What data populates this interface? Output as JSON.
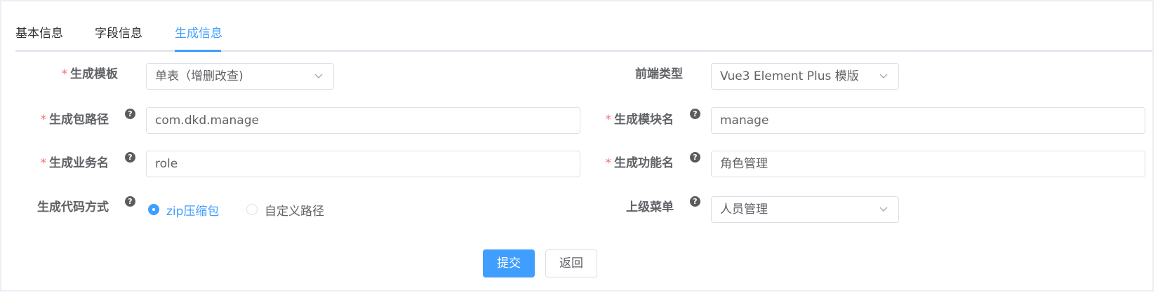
{
  "tabs": [
    {
      "label": "基本信息",
      "active": false
    },
    {
      "label": "字段信息",
      "active": false
    },
    {
      "label": "生成信息",
      "active": true
    }
  ],
  "form": {
    "tpl_category": {
      "label": "生成模板",
      "required": true,
      "value": "单表（增删改查)"
    },
    "tpl_web_type": {
      "label": "前端类型",
      "required": false,
      "value": "Vue3 Element Plus 模版"
    },
    "package_name": {
      "label": "生成包路径",
      "required": true,
      "value": "com.dkd.manage"
    },
    "module_name": {
      "label": "生成模块名",
      "required": true,
      "value": "manage"
    },
    "business_name": {
      "label": "生成业务名",
      "required": true,
      "value": "role"
    },
    "function_name": {
      "label": "生成功能名",
      "required": true,
      "value": "角色管理"
    },
    "gen_type": {
      "label": "生成代码方式",
      "options": [
        {
          "label": "zip压缩包",
          "checked": true
        },
        {
          "label": "自定义路径",
          "checked": false
        }
      ]
    },
    "parent_menu": {
      "label": "上级菜单",
      "required": false,
      "value": "人员管理"
    }
  },
  "icons": {
    "help": "?"
  },
  "buttons": {
    "submit": "提交",
    "back": "返回"
  },
  "colors": {
    "primary": "#409eff",
    "required": "#f56c6c",
    "border": "#dcdfe6"
  }
}
